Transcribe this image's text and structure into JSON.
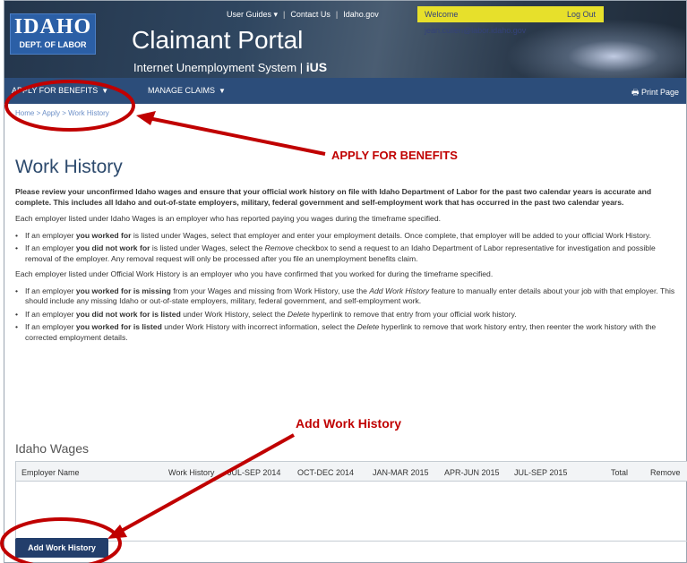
{
  "header": {
    "logo_line1": "IDAHO",
    "logo_line2": "DEPT. OF LABOR",
    "title": "Claimant Portal",
    "subtitle": "Internet Unemployment System |",
    "subtitle_mark": "iUS",
    "util_links": [
      "User Guides ▾",
      "Contact Us",
      "Idaho.gov"
    ],
    "welcome": "Welcome jean.cullen@labor.idaho.gov",
    "logout": "Log Out"
  },
  "nav": {
    "apply": "APPLY FOR BENEFITS",
    "manage": "MANAGE CLAIMS",
    "print": "Print Page"
  },
  "breadcrumb": "Home > Apply > Work History",
  "page_title": "Work History",
  "content": {
    "intro_bold": "Please review your unconfirmed Idaho wages and ensure that your official work history on file with Idaho Department of Labor for the past two calendar years is accurate and complete. This includes all Idaho and out-of-state employers, military, federal government and self-employment work that has occurred in the past two calendar years.",
    "wages_para": "Each employer listed under Idaho Wages is an employer who has reported paying you wages during the timeframe specified.",
    "bullet1_a": "If an employer ",
    "bullet1_b": "you worked for",
    "bullet1_c": " is listed under Wages, select that employer and enter your employment details. Once complete, that employer will be added to your official Work History.",
    "bullet2_a": "If an employer ",
    "bullet2_b": "you did not work for",
    "bullet2_c": " is listed under Wages, select the ",
    "bullet2_d": "Remove",
    "bullet2_e": " checkbox to send a request to an Idaho Department of Labor representative for investigation and possible removal of the employer. Any removal request will only be processed after you file an unemployment benefits claim.",
    "history_para": "Each employer listed under Official Work History is an employer who you have confirmed that you worked for during the timeframe specified.",
    "bullet3_a": "If an employer ",
    "bullet3_b": "you worked for is missing",
    "bullet3_c": " from your Wages and missing from Work History, use the ",
    "bullet3_d": "Add Work History",
    "bullet3_e": " feature to manually enter details about your job with that employer. This should include any missing Idaho or out-of-state employers, military, federal government, and self-employment work.",
    "bullet4_a": "If an employer ",
    "bullet4_b": "you did not work for is listed",
    "bullet4_c": " under Work History, select the ",
    "bullet4_d": "Delete",
    "bullet4_e": " hyperlink to remove that entry from your official work history.",
    "bullet5_a": "If an employer ",
    "bullet5_b": "you worked for is listed",
    "bullet5_c": " under Work History with incorrect information, select the ",
    "bullet5_d": "Delete",
    "bullet5_e": " hyperlink to remove that work history entry, then reenter the work history with the corrected employment details."
  },
  "wages": {
    "section_title": "Idaho Wages",
    "columns": [
      "Employer Name",
      "Work History",
      "JUL-SEP 2014",
      "OCT-DEC 2014",
      "JAN-MAR 2015",
      "APR-JUN 2015",
      "JUL-SEP 2015",
      "Total",
      "Remove"
    ]
  },
  "add_button": "Add Work History",
  "annotations": {
    "apply_label": "APPLY FOR BENEFITS",
    "add_label": "Add Work History",
    "color": "#c00000"
  }
}
